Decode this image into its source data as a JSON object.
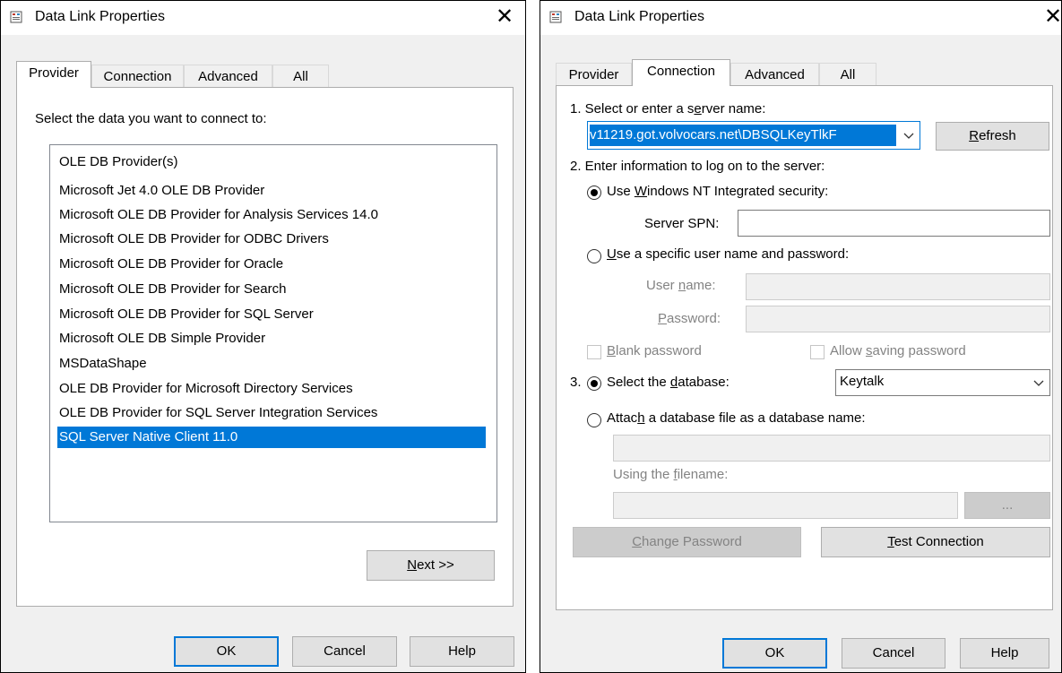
{
  "left_dialog": {
    "title": "Data Link Properties",
    "tabs": [
      "Provider",
      "Connection",
      "Advanced",
      "All"
    ],
    "prompt": "Select the data you want to connect to:",
    "providers": [
      "OLE DB Provider(s)",
      "Microsoft Jet 4.0 OLE DB Provider",
      "Microsoft OLE DB Provider for Analysis Services 14.0",
      "Microsoft OLE DB Provider for ODBC Drivers",
      "Microsoft OLE DB Provider for Oracle",
      "Microsoft OLE DB Provider for Search",
      "Microsoft OLE DB Provider for SQL Server",
      "Microsoft OLE DB Simple Provider",
      "MSDataShape",
      "OLE DB Provider for Microsoft Directory Services",
      "OLE DB Provider for SQL Server Integration Services",
      "SQL Server Native Client 11.0"
    ],
    "selected_provider": "SQL Server Native Client 11.0",
    "next": {
      "pre": "",
      "mnemonic": "N",
      "post": "ext >>"
    },
    "buttons": {
      "ok": "OK",
      "cancel": "Cancel",
      "help": "Help"
    }
  },
  "right_dialog": {
    "title": "Data Link Properties",
    "tabs": [
      "Provider",
      "Connection",
      "Advanced",
      "All"
    ],
    "step1": {
      "pre": "1. Select or enter a s",
      "mnemonic": "e",
      "post": "rver name:"
    },
    "server_value": "v11219.got.volvocars.net\\DBSQLKeyTlkF",
    "refresh": {
      "pre": "",
      "mnemonic": "R",
      "post": "efresh"
    },
    "step2": "2. Enter information to log on to the server:",
    "use_windows": {
      "pre": "Use ",
      "mnemonic": "W",
      "post": "indows NT Integrated security:"
    },
    "server_spn_label": "Server SPN:",
    "server_spn_value": "",
    "use_specific": {
      "pre": "",
      "mnemonic": "U",
      "post": "se a specific user name and password:"
    },
    "user_name": {
      "pre": "User ",
      "mnemonic": "n",
      "post": "ame:"
    },
    "password": {
      "pre": "",
      "mnemonic": "P",
      "post": "assword:"
    },
    "blank_password": {
      "pre": "",
      "mnemonic": "B",
      "post": "lank password"
    },
    "allow_saving": {
      "pre": "Allow ",
      "mnemonic": "s",
      "post": "aving password"
    },
    "step3_prefix": "3.",
    "select_db": {
      "pre": "Select the ",
      "mnemonic": "d",
      "post": "atabase:"
    },
    "database_value": "Keytalk",
    "attach": {
      "pre": "Attac",
      "mnemonic": "h",
      "post": " a database file as a database name:"
    },
    "attach_value": "",
    "using_filename": {
      "pre": "Using the ",
      "mnemonic": "f",
      "post": "ilename:"
    },
    "filename_value": "",
    "browse": "...",
    "change_password": {
      "pre": "",
      "mnemonic": "C",
      "post": "hange Password"
    },
    "test_connection": {
      "pre": "",
      "mnemonic": "T",
      "post": "est Connection"
    },
    "buttons": {
      "ok": "OK",
      "cancel": "Cancel",
      "help": "Help"
    }
  }
}
